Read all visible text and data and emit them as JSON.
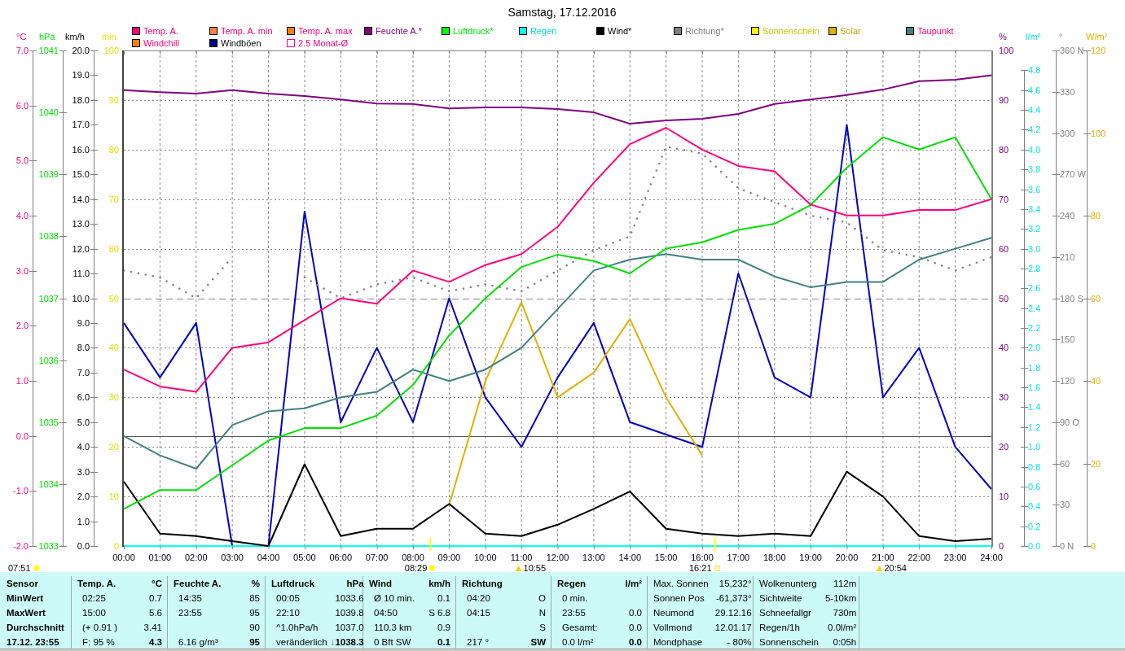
{
  "legend": {
    "rows": [
      {
        "items": [
          {
            "label": "Temp. A.",
            "color": "#ff0080",
            "kind": "filled"
          },
          {
            "label": "Temp. A. min",
            "color": "#ff8040",
            "kind": "filled"
          },
          {
            "label": "Temp. A. max",
            "color": "#ff8000",
            "kind": "filled"
          },
          {
            "label": "Feuchte A.*",
            "color": "#800080",
            "kind": "filled"
          },
          {
            "label": "Luftdruck*",
            "color": "#00ff00",
            "kind": "filled"
          },
          {
            "label": "Regen",
            "color": "#00ffff",
            "kind": "filled"
          },
          {
            "label": "Wind*",
            "color": "#000000",
            "kind": "filled"
          },
          {
            "label": "Richtung*",
            "color": "#808080",
            "kind": "filled"
          },
          {
            "label": "Sonnenschein",
            "color": "#ffff00",
            "kind": "filled"
          },
          {
            "label": "Solar",
            "color": "#e0b000",
            "kind": "filled"
          },
          {
            "label": "Taupunkt",
            "color": "#408080",
            "kind": "filled"
          }
        ]
      },
      {
        "items": [
          {
            "label": "Windchill",
            "color": "#ff8000",
            "kind": "filled"
          },
          {
            "label": "Windböen",
            "color": "#000080",
            "kind": "filled"
          },
          {
            "label": "2.5 Monat-Ø",
            "color": "#ff0080",
            "kind": "outline"
          }
        ]
      }
    ]
  },
  "axes": [
    {
      "unit": "°C",
      "ticks": [
        "7.0",
        "6.0",
        "5.0",
        "4.0",
        "3.0",
        "2.0",
        "1.0",
        "0.0",
        "-1.0",
        "-2.0"
      ]
    },
    {
      "unit": "hPa",
      "ticks": [
        "1041",
        "1040",
        "1039",
        "1038",
        "1037",
        "1036",
        "1035",
        "1034",
        "1033"
      ]
    },
    {
      "unit": "km/h",
      "ticks": [
        "20.0",
        "19.0",
        "18.0",
        "17.0",
        "16.0",
        "15.0",
        "14.0",
        "13.0",
        "12.0",
        "11.0",
        "10.0",
        "9.0",
        "8.0",
        "7.0",
        "6.0",
        "5.0",
        "4.0",
        "3.0",
        "2.0",
        "1.0",
        "0.0"
      ]
    },
    {
      "unit": "%",
      "ticks": [
        "100",
        "90",
        "80",
        "70",
        "60",
        "50",
        "40",
        "30",
        "20",
        "10",
        "0"
      ]
    },
    {
      "unit": "l/m²",
      "ticks": [
        "4.8",
        "4.6",
        "4.4",
        "4.2",
        "4.0",
        "3.8",
        "3.6",
        "3.4",
        "3.2",
        "3.0",
        "2.8",
        "2.6",
        "2.4",
        "2.2",
        "2.0",
        "1.8",
        "1.6",
        "1.4",
        "1.2",
        "1.0",
        "0.8",
        "0.6",
        "0.4",
        "0.2",
        "0.0"
      ]
    },
    {
      "unit": "°",
      "ticks": [
        "360 N",
        "330",
        "300",
        "270 W",
        "240",
        "210",
        "180 S",
        "150",
        "120",
        "90 O",
        "60",
        "30",
        "0 N"
      ]
    },
    {
      "unit": "W/m²",
      "ticks": [
        "120",
        "100",
        "80",
        "60",
        "40",
        "20",
        "0"
      ]
    }
  ],
  "chart_data": {
    "type": "line",
    "title": "Samstag, 17.12.2016",
    "ylabel": "min",
    "x": [
      0,
      1,
      2,
      3,
      4,
      5,
      6,
      7,
      8,
      9,
      10,
      11,
      12,
      13,
      14,
      15,
      16,
      17,
      18,
      19,
      20,
      21,
      22,
      23,
      24
    ],
    "xlim": [
      0,
      24
    ],
    "ylim": [
      0,
      100
    ],
    "xticks": [
      {
        "value": 0,
        "label": "00:00"
      },
      {
        "value": 1,
        "label": "01:00"
      },
      {
        "value": 2,
        "label": "02:00"
      },
      {
        "value": 3,
        "label": "03:00"
      },
      {
        "value": 4,
        "label": "04:00"
      },
      {
        "value": 5,
        "label": "05:00"
      },
      {
        "value": 6,
        "label": "06:00"
      },
      {
        "value": 7,
        "label": "07:00"
      },
      {
        "value": 8,
        "label": "08:00"
      },
      {
        "value": 9,
        "label": "09:00"
      },
      {
        "value": 10,
        "label": "10:00"
      },
      {
        "value": 11,
        "label": "11:00"
      },
      {
        "value": 12,
        "label": "12:00"
      },
      {
        "value": 13,
        "label": "13:00"
      },
      {
        "value": 14,
        "label": "14:00"
      },
      {
        "value": 15,
        "label": "15:00"
      },
      {
        "value": 16,
        "label": "16:00"
      },
      {
        "value": 17,
        "label": "17:00"
      },
      {
        "value": 18,
        "label": "18:00"
      },
      {
        "value": 19,
        "label": "19:00"
      },
      {
        "value": 20,
        "label": "20:00"
      },
      {
        "value": 21,
        "label": "21:00"
      },
      {
        "value": 22,
        "label": "22:00"
      },
      {
        "value": 23,
        "label": "23:00"
      },
      {
        "value": 24,
        "label": "24:00"
      }
    ],
    "yticks": [
      {
        "value": 100,
        "label": "100"
      },
      {
        "value": 90,
        "label": "90"
      },
      {
        "value": 80,
        "label": "80"
      },
      {
        "value": 70,
        "label": "70"
      },
      {
        "value": 60,
        "label": "60"
      },
      {
        "value": 50,
        "label": "50"
      },
      {
        "value": 40,
        "label": "40"
      },
      {
        "value": 30,
        "label": "30"
      },
      {
        "value": 20,
        "label": "20"
      },
      {
        "value": 10,
        "label": "10"
      },
      {
        "value": 0,
        "label": "0"
      }
    ],
    "series": [
      {
        "color": "#0000c0",
        "values": [
          45,
          34,
          45,
          0,
          0,
          67.5,
          25,
          40,
          25,
          50,
          30,
          20,
          34,
          45,
          25,
          22.5,
          20,
          55,
          34,
          30,
          85,
          30,
          40,
          20,
          11.5
        ]
      },
      {
        "color": "#e0b000",
        "values": [
          null,
          null,
          null,
          null,
          null,
          null,
          null,
          null,
          null,
          8.3,
          33.3,
          49.2,
          30,
          35,
          45.8,
          30,
          18.3,
          null,
          null,
          null,
          null,
          null,
          null,
          null,
          null
        ]
      },
      {
        "color": "#00ffff",
        "values": [
          0,
          0,
          0,
          0,
          0,
          0,
          0,
          0,
          0,
          0,
          0,
          0,
          0,
          0,
          0,
          0,
          0,
          0,
          0,
          0,
          0,
          0,
          0,
          0,
          0
        ]
      },
      {
        "color": "#808080",
        "line_style": "dotted",
        "values": [
          55.6,
          54.2,
          50,
          58.3,
          null,
          54.2,
          50,
          52.8,
          54.2,
          51.4,
          52.8,
          51.4,
          55.6,
          59.7,
          62.5,
          80.6,
          79.2,
          72.2,
          69.4,
          66.7,
          65.3,
          59.7,
          58.3,
          55.6,
          58.3
        ]
      },
      {
        "color": "#000000",
        "values": [
          13,
          2.5,
          2,
          1,
          0,
          16.5,
          2,
          3.5,
          3.5,
          8.5,
          2.5,
          2,
          4.3,
          7.5,
          11,
          3.5,
          2.5,
          2,
          2.5,
          2,
          15,
          10,
          2,
          1,
          1.5
        ]
      },
      {
        "color": "#408080",
        "values": [
          22.2,
          18.3,
          15.6,
          24.4,
          27.2,
          27.8,
          30,
          31.1,
          35.6,
          33.3,
          35.6,
          40,
          47.8,
          55.6,
          57.8,
          58.9,
          57.8,
          57.8,
          54.4,
          52.2,
          53.3,
          53.3,
          57.8,
          60,
          62.2
        ]
      },
      {
        "color": "#00e000",
        "values": [
          7.5,
          11.3,
          11.3,
          16.3,
          21.3,
          23.8,
          23.8,
          26.3,
          32.5,
          42.5,
          50,
          56.3,
          58.8,
          57.5,
          55,
          60,
          61.3,
          63.8,
          65,
          68.8,
          76.3,
          82.5,
          80,
          82.5,
          70
        ]
      },
      {
        "color": "#800080",
        "values": [
          92,
          91.6,
          91.3,
          92,
          91.3,
          90.8,
          90.1,
          89.3,
          89.2,
          88.3,
          88.5,
          88.5,
          88.2,
          87.5,
          85.2,
          85.9,
          86.2,
          87.2,
          89.2,
          90.1,
          91,
          92.1,
          93.8,
          94.1,
          95
        ]
      },
      {
        "color": "#ff0080",
        "values": [
          35.6,
          32.2,
          31.1,
          40,
          41.1,
          45.6,
          50,
          48.9,
          55.6,
          53.3,
          56.7,
          58.9,
          64.4,
          73.3,
          81.1,
          84.4,
          80,
          76.7,
          75.6,
          68.9,
          66.7,
          66.7,
          67.8,
          67.8,
          70
        ]
      }
    ]
  },
  "time_markers": [
    {
      "time": "08:29",
      "kind": "sun-dot"
    },
    {
      "time": "10:55",
      "kind": "triangle"
    },
    {
      "time": "16:21",
      "kind": "sun-square"
    },
    {
      "time": "20:54",
      "kind": "triangle"
    }
  ],
  "sunrise": {
    "time": "07:51"
  },
  "stats": {
    "sensor": {
      "header": "Sensor",
      "rows": [
        "MinWert",
        "MaxWert",
        "Durchschnitt",
        "17.12. 23:55"
      ]
    },
    "groups": [
      {
        "kind": "measure",
        "header": "Temp. A.",
        "unit": "°C",
        "rows": [
          {
            "label": "02:25",
            "value": "0.7"
          },
          {
            "label": "15:00",
            "value": "5.6"
          },
          {
            "label": "(+ 0.91 )",
            "value": "3.41"
          },
          {
            "label": "F: 95 %",
            "value": "4.3"
          }
        ]
      },
      {
        "kind": "measure",
        "header": "Feuchte A.",
        "unit": "%",
        "rows": [
          {
            "label": "14:35",
            "value": "85"
          },
          {
            "label": "23:55",
            "value": "95"
          },
          {
            "value": "90"
          },
          {
            "label": "6.16 g/m³",
            "value": "95"
          }
        ]
      },
      {
        "kind": "measure",
        "header": "Luftdruck",
        "unit": "hPa",
        "rows": [
          {
            "label": "00:05",
            "value": "1033.6"
          },
          {
            "label": "22:10",
            "value": "1039.8"
          },
          {
            "label": "^1.0hPa/h",
            "value": "1037.0"
          },
          {
            "label": "veränderlich",
            "trend": "↓",
            "value": "1038.3"
          }
        ]
      },
      {
        "kind": "measure",
        "header": "Wind",
        "unit": "km/h",
        "rows": [
          {
            "label": "Ø 10 min.",
            "value": "0.1"
          },
          {
            "label": "04:50",
            "value": "S 6.8"
          },
          {
            "label": "110.3 km",
            "value": "0.9"
          },
          {
            "label": "0 Bft SW",
            "value": "0.1"
          }
        ]
      },
      {
        "kind": "measure",
        "header": "Richtung",
        "rows": [
          {
            "label": "04:20",
            "value": "O"
          },
          {
            "label": "04:15",
            "value": "N"
          },
          {
            "value": "S"
          },
          {
            "label": "217 °",
            "value": "SW"
          }
        ]
      },
      {
        "kind": "measure",
        "header": "Regen",
        "unit": "l/m²",
        "rows": [
          {
            "label": "0 min."
          },
          {
            "label": "23:55",
            "value": "0.0"
          },
          {
            "label": "Gesamt:",
            "value": "0.0"
          },
          {
            "label": "0.0 l/m²",
            "value": "0.0"
          }
        ]
      },
      {
        "kind": "info",
        "rows": [
          {
            "label": "Max. Sonnen",
            "value": "15,232°"
          },
          {
            "label": "Sonnen Pos",
            "value": "-61,373°"
          },
          {
            "label": "Neumond",
            "value": "29.12.16"
          },
          {
            "label": "Vollmond",
            "value": "12.01.17"
          },
          {
            "label": "Mondphase",
            "value": "- 80%"
          }
        ]
      },
      {
        "kind": "info",
        "rows": [
          {
            "label": "Wolkenunterg",
            "value": "112m"
          },
          {
            "label": "Sichtweite",
            "value": "5-10km"
          },
          {
            "label": "Schneefallgr",
            "value": "730m"
          },
          {
            "label": "Regen/1h",
            "value": "0.0l/m²"
          },
          {
            "label": "Sonnenschein",
            "value": "0:05h"
          }
        ]
      }
    ]
  }
}
